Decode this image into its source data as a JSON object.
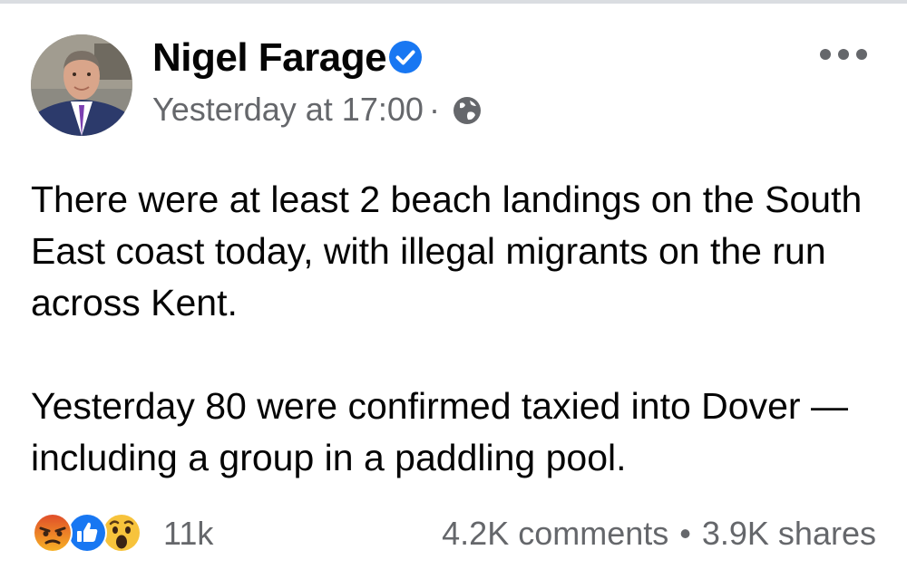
{
  "post": {
    "author": {
      "name": "Nigel Farage",
      "verified": true
    },
    "timestamp": "Yesterday at 17:00",
    "separator": "·",
    "audience_icon": "globe-icon",
    "more_icon": "more-options-icon",
    "paragraphs": [
      "There were at least 2 beach landings on the South East coast today, with illegal migrants on the run across Kent.",
      "Yesterday 80 were confirmed taxied into Dover — including a group in a paddling pool."
    ],
    "reactions": {
      "icons": [
        "angry-reaction-icon",
        "like-reaction-icon",
        "wow-reaction-icon"
      ],
      "count": "11k"
    },
    "comments": "4.2K comments",
    "shares": "3.9K shares",
    "stats_separator": "•"
  },
  "colors": {
    "text": "#050505",
    "secondary": "#65676b",
    "verified_blue": "#1877f2",
    "divider": "#dadde1"
  }
}
